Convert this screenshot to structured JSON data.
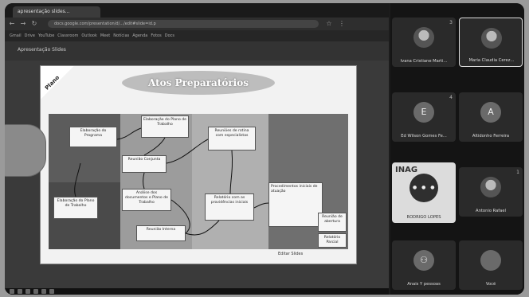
{
  "browser": {
    "tab_title": "apresentação slides...",
    "url": "docs.google.com/presentation/d/.../edit#slide=id.p",
    "bookmarks": [
      "Gmail",
      "Drive",
      "YouTube",
      "Classroom",
      "Outlook",
      "Meet",
      "Notícias",
      "Agenda",
      "Fotos",
      "Docs"
    ],
    "doc_name": "Apresentação Slides"
  },
  "slide": {
    "corner_label": "Plano",
    "title": "Atos Preparatórios",
    "footnote": "Editar  Slides",
    "boxes": [
      "Elaboração do Programa",
      "Elaboração do Plano de Trabalho",
      "Reunião Conjunta",
      "Reuniões de rotina com especialistas",
      "Análise dos documentos e Plano de Trabalho",
      "Relatório com as providências iniciais",
      "Reunião Interna",
      "Elaboração do Plano de Trabalho",
      "Procedimentos iniciais de atuação",
      "Reunião de abertura",
      "Relatório Parcial"
    ]
  },
  "participants": [
    {
      "name": "Ivana Cristiane Marti...",
      "initial": "",
      "number": "3"
    },
    {
      "name": "Maria Claudia Cerez...",
      "initial": "",
      "number": ""
    },
    {
      "name": "Ed Wilson Gomes Fe...",
      "initial": "E",
      "number": "4"
    },
    {
      "name": "Altidonho Ferreira",
      "initial": "A",
      "number": ""
    },
    {
      "name": "RODRIGO LOPES",
      "initial": "",
      "number": "",
      "brand": "INAG"
    },
    {
      "name": "Antonio Rafael",
      "initial": "",
      "number": "1"
    },
    {
      "name": "Anais Y pessoas",
      "initial": "",
      "number": ""
    },
    {
      "name": "Você",
      "initial": "",
      "number": ""
    }
  ]
}
